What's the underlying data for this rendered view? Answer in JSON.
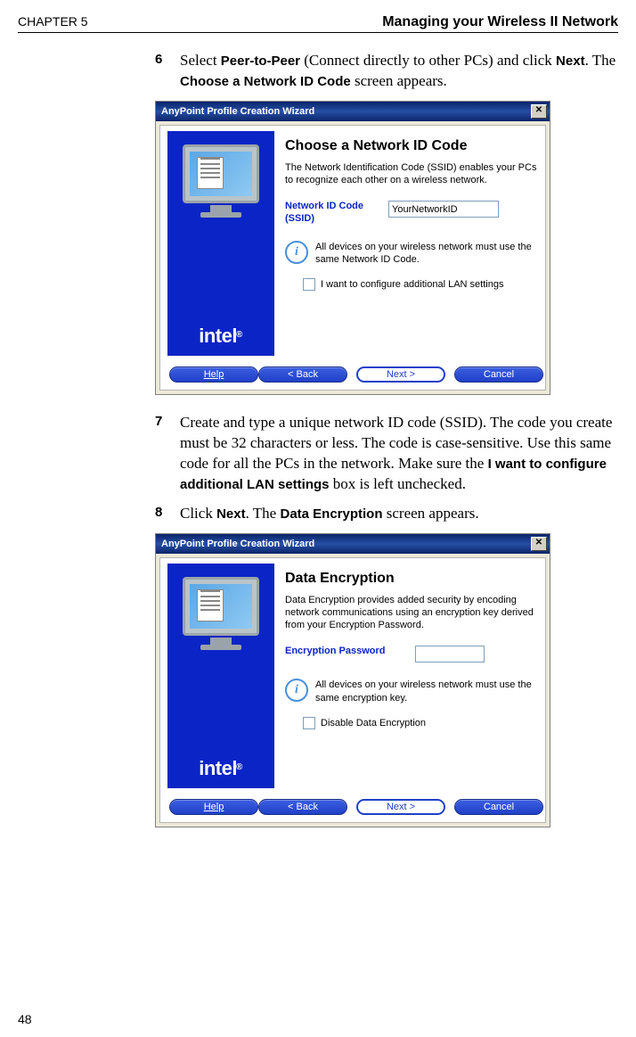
{
  "header": {
    "chapter": "CHAPTER 5",
    "title": "Managing your Wireless II Network"
  },
  "steps": {
    "s6": {
      "num": "6",
      "pre": "Select ",
      "bold1": "Peer-to-Peer",
      "mid": " (Connect directly to other PCs) and click ",
      "bold2": "Next",
      "post1": ". The ",
      "bold3": "Choose a Network ID Code",
      "post2": " screen appears."
    },
    "s7": {
      "num": "7",
      "t1": "Create and type a unique network ID code (SSID). The code you create must be 32 characters or less. The code is case-sensitive. Use this same code for all the PCs in the network. Make sure the ",
      "bold1": "I want to configure additional LAN settings",
      "t2": " box is left unchecked."
    },
    "s8": {
      "num": "8",
      "t1": "Click ",
      "bold1": "Next",
      "t2": ". The ",
      "bold2": "Data Encryption",
      "t3": " screen appears."
    }
  },
  "wiz_common": {
    "title": "AnyPoint Profile Creation Wizard",
    "close_glyph": "✕",
    "logo": "intel",
    "help": "Help",
    "back": "< Back",
    "next": "Next >",
    "cancel": "Cancel",
    "info_glyph": "i"
  },
  "wiz1": {
    "heading": "Choose a Network ID Code",
    "desc": "The Network Identification Code (SSID) enables your PCs to recognize each other on a wireless network.",
    "field_label": "Network ID Code (SSID)",
    "field_value": "YourNetworkID",
    "info_text": "All devices on your wireless network must use the same Network ID Code.",
    "checkbox_label": "I want to configure additional LAN settings"
  },
  "wiz2": {
    "heading": "Data Encryption",
    "desc": "Data Encryption provides added security by encoding network communications using an encryption key derived from your Encryption Password.",
    "field_label": "Encryption Password",
    "field_value": "",
    "info_text": "All devices on your wireless network must use the same encryption key.",
    "checkbox_label": "Disable Data Encryption"
  },
  "page_number": "48"
}
